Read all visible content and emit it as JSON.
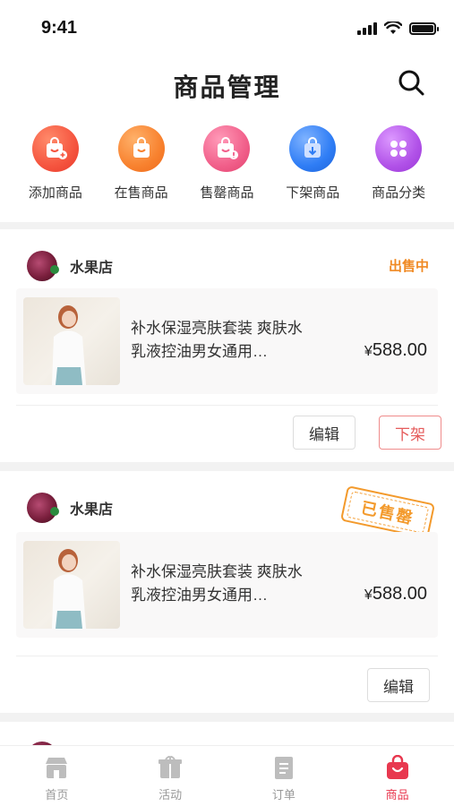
{
  "status_bar": {
    "time": "9:41"
  },
  "header": {
    "title": "商品管理"
  },
  "quick_nav": [
    {
      "label": "添加商品",
      "icon": "add-product-icon",
      "color": "#f5553f"
    },
    {
      "label": "在售商品",
      "icon": "on-sale-icon",
      "color": "#f8822f"
    },
    {
      "label": "售罄商品",
      "icon": "sold-out-icon",
      "color": "#f15f8a"
    },
    {
      "label": "下架商品",
      "icon": "delisted-icon",
      "color": "#2f7df5"
    },
    {
      "label": "商品分类",
      "icon": "category-icon",
      "color": "#b152e8"
    }
  ],
  "cards": [
    {
      "shop_name": "水果店",
      "status_text": "出售中",
      "product_title": "补水保湿亮肤套装 爽肤水乳液控油男女通用…",
      "price_symbol": "¥",
      "price": "588.00",
      "buttons": {
        "edit": "编辑",
        "delist": "下架"
      }
    },
    {
      "shop_name": "水果店",
      "stamp_text": "已售罄",
      "product_title": "补水保湿亮肤套装 爽肤水乳液控油男女通用…",
      "price_symbol": "¥",
      "price": "588.00",
      "buttons": {
        "edit": "编辑"
      }
    }
  ],
  "tab_bar": [
    {
      "label": "首页",
      "icon": "home-icon",
      "active": false
    },
    {
      "label": "活动",
      "icon": "activity-icon",
      "active": false
    },
    {
      "label": "订单",
      "icon": "order-icon",
      "active": false
    },
    {
      "label": "商品",
      "icon": "product-bag-icon",
      "active": true
    }
  ],
  "colors": {
    "accent": "#e8384f",
    "on_sale": "#f08a24",
    "sold_out_stamp": "#f39a2c"
  }
}
